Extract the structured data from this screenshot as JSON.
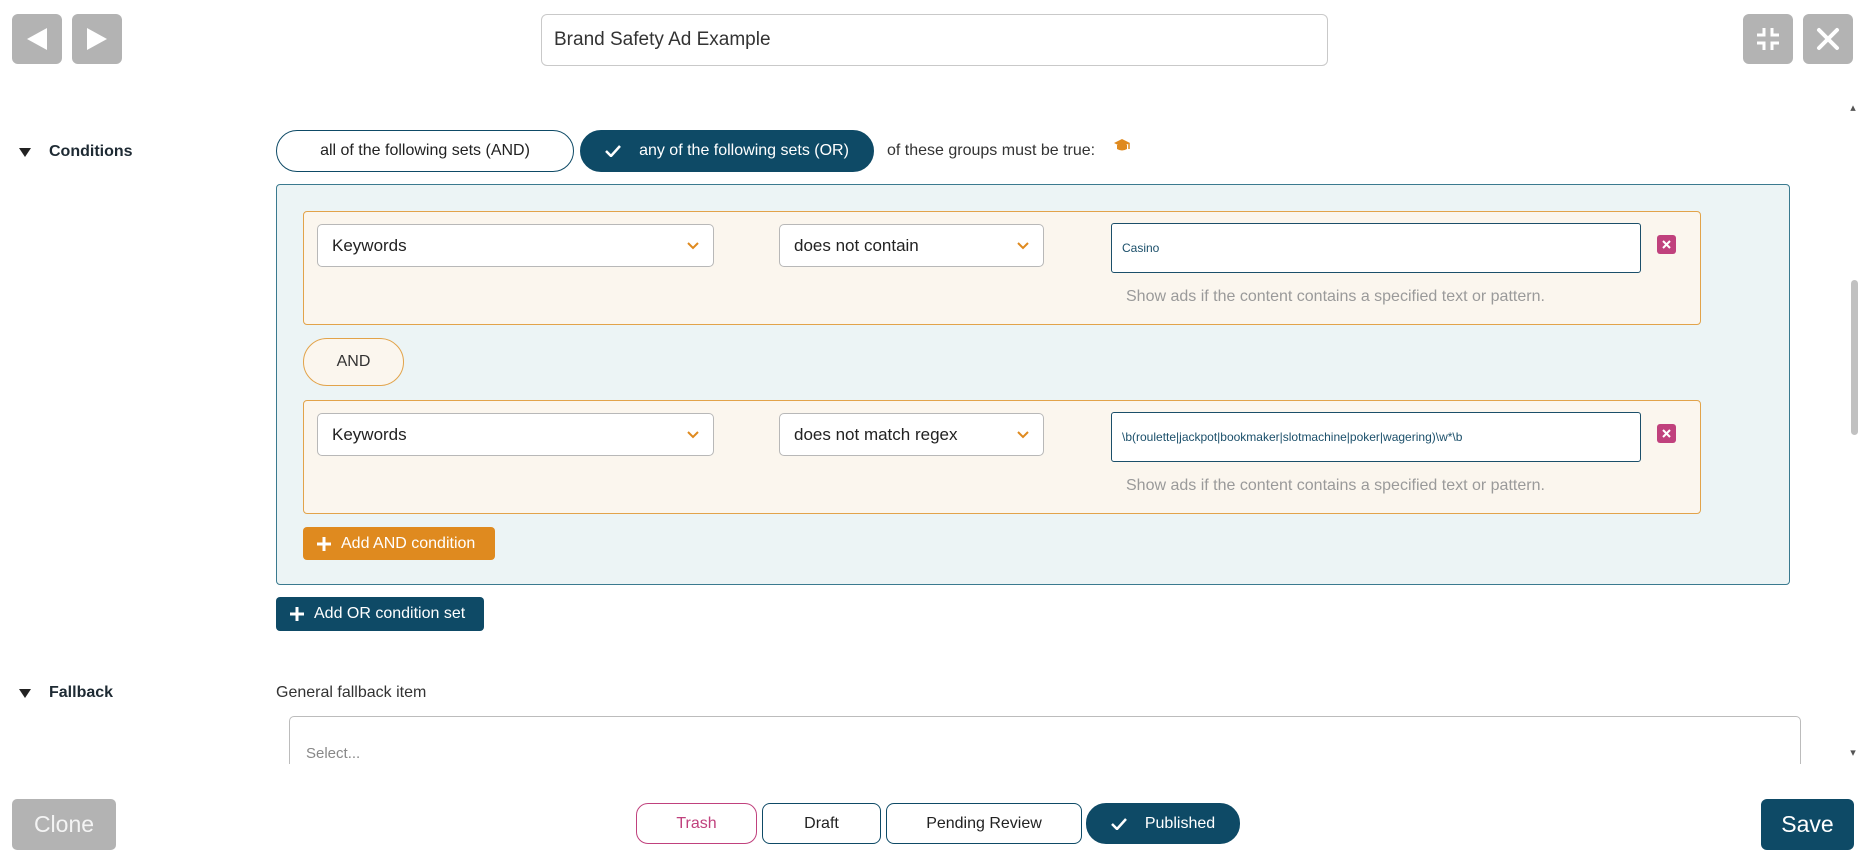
{
  "header": {
    "back_icon": "triangle-left-icon",
    "forward_icon": "triangle-right-icon",
    "title_value": "Brand Safety Ad Example",
    "shrink_icon": "compress-arrows-icon",
    "close_icon": "close-x-icon"
  },
  "conditions": {
    "section_label": "Conditions",
    "mode_and_label": "all of the following sets (AND)",
    "mode_or_label": "any of the following sets (OR)",
    "mode_selected": "OR",
    "suffix_text": "of these groups must be true:",
    "help_icon": "graduation-cap-icon",
    "rows": [
      {
        "field": "Keywords",
        "operator": "does not contain",
        "value": "Casino",
        "hint": "Show ads if the content contains a specified text or pattern."
      },
      {
        "field": "Keywords",
        "operator": "does not match regex",
        "value": "\\b(roulette|jackpot|bookmaker|slotmachine|poker|wagering)\\w*\\b",
        "hint": "Show ads if the content contains a specified text or pattern."
      }
    ],
    "and_connector": "AND",
    "add_and_label": "Add AND condition",
    "add_or_label": "Add OR condition set"
  },
  "fallback": {
    "section_label": "Fallback",
    "general_label": "General fallback item",
    "select_placeholder": "Select..."
  },
  "footer": {
    "clone_label": "Clone",
    "trash_label": "Trash",
    "draft_label": "Draft",
    "pending_label": "Pending Review",
    "published_label": "Published",
    "status_selected": "Published",
    "save_label": "Save"
  },
  "colors": {
    "primary": "#0e4a66",
    "accent_orange": "#df8a1f",
    "danger": "#c0417d",
    "group_bg": "#ecf4f5",
    "row_bg": "#fbf6ee"
  }
}
